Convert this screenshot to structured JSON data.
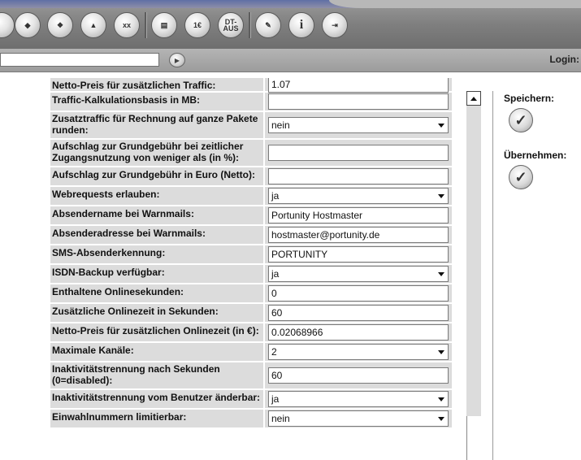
{
  "toolbar": {
    "buttons": [
      {
        "icon": "partial-round-icon",
        "text": ""
      },
      {
        "icon": "cube-icon",
        "text": ""
      },
      {
        "icon": "cubes-icon",
        "text": ""
      },
      {
        "icon": "pyramid-icon",
        "text": ""
      },
      {
        "icon": "tools-xx-icon",
        "text": "xx"
      },
      {
        "icon": "document-icon",
        "text": ""
      },
      {
        "icon": "euro-document-icon",
        "text": "1€"
      },
      {
        "icon": "dt-aus-icon",
        "text": "DT-\nAUS"
      },
      {
        "icon": "settings-tools-icon",
        "text": ""
      },
      {
        "icon": "info-icon",
        "text": "i"
      },
      {
        "icon": "exit-icon",
        "text": ""
      }
    ]
  },
  "address": {
    "value": "",
    "login_label": "Login:"
  },
  "form": {
    "rows": [
      {
        "label": "Netto-Preis für zusätzlichen Traffic:",
        "value": "1.07",
        "type": "text"
      },
      {
        "label": "Traffic-Kalkulationsbasis in MB:",
        "value": "",
        "type": "text"
      },
      {
        "label": "Zusatztraffic für Rechnung auf ganze Pakete runden:",
        "value": "nein",
        "type": "select"
      },
      {
        "label": "Aufschlag zur Grundgebühr bei zeitlicher Zugangsnutzung von weniger als (in %):",
        "value": "",
        "type": "text"
      },
      {
        "label": "Aufschlag zur Grundgebühr in Euro (Netto):",
        "value": "",
        "type": "text"
      },
      {
        "label": "Webrequests erlauben:",
        "value": "ja",
        "type": "select"
      },
      {
        "label": "Absendername bei Warnmails:",
        "value": "Portunity Hostmaster",
        "type": "text"
      },
      {
        "label": "Absenderadresse bei Warnmails:",
        "value": "hostmaster@portunity.de",
        "type": "text"
      },
      {
        "label": "SMS-Absenderkennung:",
        "value": "PORTUNITY",
        "type": "text"
      },
      {
        "label": "ISDN-Backup verfügbar:",
        "value": "ja",
        "type": "select"
      },
      {
        "label": "Enthaltene Onlinesekunden:",
        "value": "0",
        "type": "text"
      },
      {
        "label": "Zusätzliche Onlinezeit in Sekunden:",
        "value": "60",
        "type": "text"
      },
      {
        "label": "Netto-Preis für zusätzlichen Onlinezeit (in €):",
        "value": "0.02068966",
        "type": "text"
      },
      {
        "label": "Maximale Kanäle:",
        "value": "2",
        "type": "select"
      },
      {
        "label": "Inaktivitätstrennung nach Sekunden (0=disabled):",
        "value": "60",
        "type": "text"
      },
      {
        "label": "Inaktivitätstrennung vom Benutzer änderbar:",
        "value": "ja",
        "type": "select"
      },
      {
        "label": "Einwahlnummern limitierbar:",
        "value": "nein",
        "type": "select"
      }
    ]
  },
  "side": {
    "save_label": "Speichern:",
    "apply_label": "Übernehmen:"
  }
}
